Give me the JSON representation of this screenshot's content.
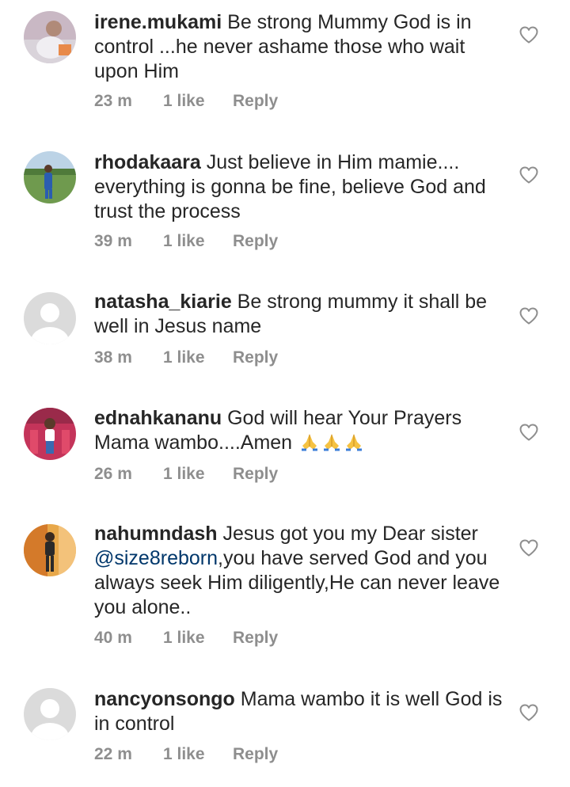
{
  "comments": [
    {
      "username": "irene.mukami",
      "text": "Be strong Mummy God is in control ...he never ashame those who wait upon Him",
      "time": "23 m",
      "likes": "1 like",
      "reply": "Reply",
      "avatar": "photo"
    },
    {
      "username": "rhodakaara",
      "text": "Just believe in Him mamie.... everything is gonna be fine, believe God and trust the process",
      "time": "39 m",
      "likes": "1 like",
      "reply": "Reply",
      "avatar": "photo"
    },
    {
      "username": "natasha_kiarie",
      "text": "Be strong mummy it shall be well in Jesus name",
      "time": "38 m",
      "likes": "1 like",
      "reply": "Reply",
      "avatar": "default"
    },
    {
      "username": "ednahkananu",
      "text": "God will hear Your Prayers Mama wambo....Amen",
      "emoji": "🙏🙏🙏",
      "time": "26 m",
      "likes": "1 like",
      "reply": "Reply",
      "avatar": "photo"
    },
    {
      "username": "nahumndash",
      "text_before": "Jesus got you my Dear sister",
      "mention": "@size8reborn",
      "text_after": ",you have served God and you always seek Him diligently,He can never leave you alone..",
      "time": "40 m",
      "likes": "1 like",
      "reply": "Reply",
      "avatar": "photo"
    },
    {
      "username": "nancyonsongo",
      "text": "Mama wambo it is well God is in control",
      "time": "22 m",
      "likes": "1 like",
      "reply": "Reply",
      "avatar": "default"
    }
  ],
  "icons": {
    "like": "heart-outline-icon",
    "default_avatar": "default-avatar-icon"
  },
  "colors": {
    "text": "#262626",
    "meta": "#8e8e8e",
    "mention": "#00376b",
    "default_avatar_bg": "#dbdbdb"
  }
}
